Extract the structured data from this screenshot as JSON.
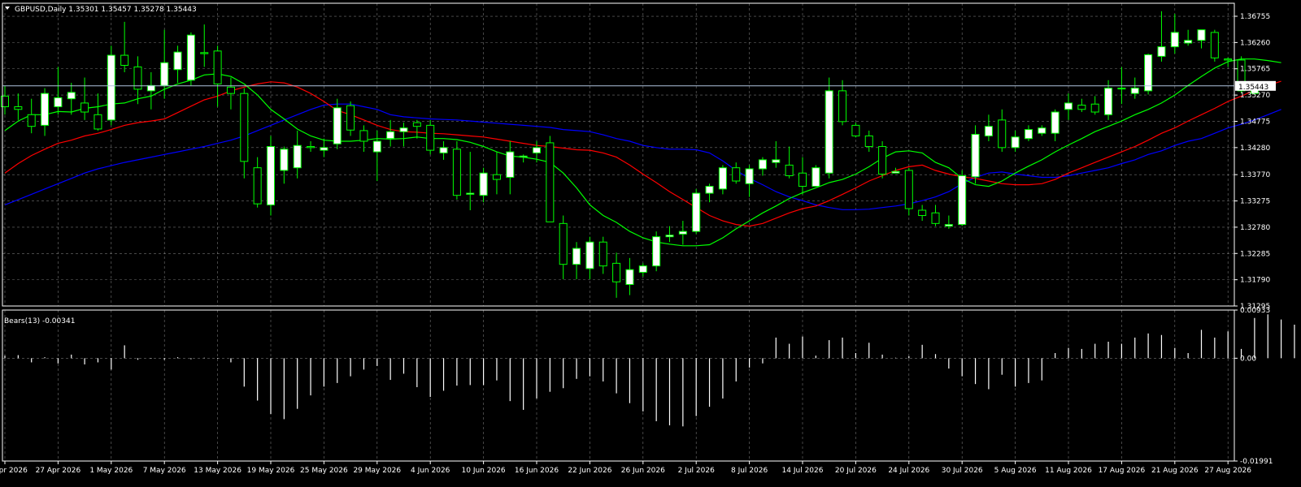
{
  "main_header": "GBPUSD,Daily  1.35301 1.35457 1.35278 1.35443",
  "indicator_header": "Bears(13) -0.00341",
  "current_price_label": "1.35443",
  "colors": {
    "background": "#000000",
    "grid": "#c0c0c0",
    "axis": "#ffffff",
    "bull_candle": "#ffffff",
    "bear_candle": "#000000",
    "wick": "#00ff00",
    "ma_fast": "#00ff00",
    "ma_mid": "#ff0000",
    "ma_slow": "#0000ff",
    "bears_hist": "#ffffff",
    "price_line": "#b0c4de"
  },
  "chart_data": [
    {
      "type": "candlestick",
      "symbol": "GBPUSD",
      "timeframe": "Daily",
      "ylim": [
        1.31295,
        1.37
      ],
      "y_ticks": [
        "1.36755",
        "1.36260",
        "1.35765",
        "1.35270",
        "1.34775",
        "1.34280",
        "1.33770",
        "1.33275",
        "1.32780",
        "1.32285",
        "1.31790",
        "1.31295"
      ],
      "x_ticks": [
        "21 Apr 2026",
        "27 Apr 2026",
        "1 May 2026",
        "7 May 2026",
        "13 May 2026",
        "19 May 2026",
        "25 May 2026",
        "29 May 2026",
        "4 Jun 2026",
        "10 Jun 2026",
        "16 Jun 2026",
        "22 Jun 2026",
        "26 Jun 2026",
        "2 Jul 2026",
        "8 Jul 2026",
        "14 Jul 2026",
        "20 Jul 2026",
        "24 Jul 2026",
        "30 Jul 2026",
        "5 Aug 2026",
        "11 Aug 2026",
        "17 Aug 2026",
        "21 Aug 2026",
        "27 Aug 2026"
      ],
      "grid": true,
      "last_price": 1.35443,
      "candles": [
        [
          1.3525,
          1.3545,
          1.349,
          1.3505
        ],
        [
          1.3505,
          1.353,
          1.348,
          1.35
        ],
        [
          1.349,
          1.352,
          1.3455,
          1.3468
        ],
        [
          1.347,
          1.354,
          1.345,
          1.353
        ],
        [
          1.3505,
          1.358,
          1.349,
          1.3522
        ],
        [
          1.352,
          1.355,
          1.349,
          1.3532
        ],
        [
          1.3512,
          1.356,
          1.348,
          1.3495
        ],
        [
          1.349,
          1.353,
          1.346,
          1.3463
        ],
        [
          1.348,
          1.362,
          1.347,
          1.3602
        ],
        [
          1.3602,
          1.3665,
          1.357,
          1.3583
        ],
        [
          1.358,
          1.36,
          1.351,
          1.3538
        ],
        [
          1.3535,
          1.357,
          1.35,
          1.3545
        ],
        [
          1.3545,
          1.365,
          1.352,
          1.3588
        ],
        [
          1.3575,
          1.362,
          1.355,
          1.3608
        ],
        [
          1.3555,
          1.3645,
          1.3545,
          1.364
        ],
        [
          1.3607,
          1.366,
          1.358,
          1.3605
        ],
        [
          1.361,
          1.362,
          1.3505,
          1.3548
        ],
        [
          1.3542,
          1.356,
          1.35,
          1.353
        ],
        [
          1.353,
          1.354,
          1.337,
          1.3402
        ],
        [
          1.339,
          1.341,
          1.3315,
          1.3322
        ],
        [
          1.332,
          1.345,
          1.33,
          1.343
        ],
        [
          1.3385,
          1.343,
          1.336,
          1.3425
        ],
        [
          1.339,
          1.346,
          1.337,
          1.3432
        ],
        [
          1.343,
          1.344,
          1.342,
          1.3428
        ],
        [
          1.3423,
          1.3445,
          1.341,
          1.3428
        ],
        [
          1.3435,
          1.352,
          1.3425,
          1.3503
        ],
        [
          1.3507,
          1.3515,
          1.345,
          1.3461
        ],
        [
          1.346,
          1.347,
          1.342,
          1.344
        ],
        [
          1.342,
          1.346,
          1.3365,
          1.344
        ],
        [
          1.3445,
          1.348,
          1.343,
          1.3458
        ],
        [
          1.3458,
          1.3475,
          1.343,
          1.3465
        ],
        [
          1.3475,
          1.348,
          1.3445,
          1.3468
        ],
        [
          1.347,
          1.348,
          1.3415,
          1.3423
        ],
        [
          1.3418,
          1.344,
          1.3405,
          1.3428
        ],
        [
          1.3425,
          1.344,
          1.333,
          1.3338
        ],
        [
          1.334,
          1.342,
          1.331,
          1.3342
        ],
        [
          1.3338,
          1.339,
          1.3325,
          1.338
        ],
        [
          1.3377,
          1.342,
          1.334,
          1.3368
        ],
        [
          1.3372,
          1.344,
          1.334,
          1.342
        ],
        [
          1.341,
          1.3415,
          1.34,
          1.3412
        ],
        [
          1.3418,
          1.344,
          1.34,
          1.3428
        ],
        [
          1.3437,
          1.345,
          1.333,
          1.3288
        ],
        [
          1.3285,
          1.33,
          1.318,
          1.3208
        ],
        [
          1.3208,
          1.325,
          1.318,
          1.3238
        ],
        [
          1.32,
          1.326,
          1.318,
          1.325
        ],
        [
          1.325,
          1.326,
          1.319,
          1.3205
        ],
        [
          1.321,
          1.323,
          1.3145,
          1.3175
        ],
        [
          1.317,
          1.322,
          1.315,
          1.3198
        ],
        [
          1.3193,
          1.321,
          1.3185,
          1.3205
        ],
        [
          1.3205,
          1.327,
          1.3195,
          1.326
        ],
        [
          1.326,
          1.328,
          1.325,
          1.3263
        ],
        [
          1.3265,
          1.329,
          1.3245,
          1.327
        ],
        [
          1.327,
          1.335,
          1.3265,
          1.3342
        ],
        [
          1.3342,
          1.336,
          1.3325,
          1.3355
        ],
        [
          1.335,
          1.3395,
          1.334,
          1.339
        ],
        [
          1.339,
          1.34,
          1.336,
          1.3365
        ],
        [
          1.336,
          1.3395,
          1.3335,
          1.3388
        ],
        [
          1.3388,
          1.341,
          1.3375,
          1.3405
        ],
        [
          1.34,
          1.344,
          1.339,
          1.3405
        ],
        [
          1.3395,
          1.343,
          1.337,
          1.3375
        ],
        [
          1.338,
          1.341,
          1.334,
          1.3355
        ],
        [
          1.3355,
          1.3395,
          1.3355,
          1.339
        ],
        [
          1.338,
          1.356,
          1.337,
          1.3535
        ],
        [
          1.3535,
          1.3555,
          1.347,
          1.3477
        ],
        [
          1.347,
          1.3475,
          1.3447,
          1.345
        ],
        [
          1.345,
          1.346,
          1.342,
          1.343
        ],
        [
          1.343,
          1.344,
          1.337,
          1.3378
        ],
        [
          1.338,
          1.339,
          1.338,
          1.3383
        ],
        [
          1.3385,
          1.339,
          1.33,
          1.3313
        ],
        [
          1.331,
          1.332,
          1.329,
          1.33
        ],
        [
          1.3305,
          1.332,
          1.328,
          1.3285
        ],
        [
          1.328,
          1.33,
          1.3275,
          1.3283
        ],
        [
          1.3283,
          1.3385,
          1.328,
          1.3375
        ],
        [
          1.3373,
          1.347,
          1.336,
          1.3453
        ],
        [
          1.345,
          1.349,
          1.344,
          1.3468
        ],
        [
          1.348,
          1.35,
          1.342,
          1.3428
        ],
        [
          1.3428,
          1.346,
          1.342,
          1.3448
        ],
        [
          1.3445,
          1.347,
          1.344,
          1.3462
        ],
        [
          1.3455,
          1.347,
          1.345,
          1.3465
        ],
        [
          1.3455,
          1.35,
          1.344,
          1.3495
        ],
        [
          1.35,
          1.353,
          1.348,
          1.3512
        ],
        [
          1.3508,
          1.352,
          1.3495,
          1.35
        ],
        [
          1.351,
          1.3525,
          1.349,
          1.3495
        ],
        [
          1.349,
          1.3555,
          1.348,
          1.354
        ],
        [
          1.354,
          1.358,
          1.351,
          1.354
        ],
        [
          1.353,
          1.356,
          1.352,
          1.354
        ],
        [
          1.3535,
          1.3605,
          1.3528,
          1.3603
        ],
        [
          1.36,
          1.3685,
          1.359,
          1.3618
        ],
        [
          1.3618,
          1.368,
          1.3605,
          1.3645
        ],
        [
          1.3625,
          1.365,
          1.362,
          1.363
        ],
        [
          1.363,
          1.365,
          1.3615,
          1.365
        ],
        [
          1.3645,
          1.365,
          1.359,
          1.3597
        ],
        [
          1.3595,
          1.3598,
          1.358,
          1.3593
        ],
        [
          1.3593,
          1.36,
          1.353,
          1.3535
        ],
        [
          1.353,
          1.3546,
          1.3528,
          1.3544
        ]
      ],
      "ma_fast": [
        1.346,
        1.3478,
        1.349,
        1.349,
        1.3496,
        1.3495,
        1.3502,
        1.3505,
        1.351,
        1.3512,
        1.352,
        1.3525,
        1.3538,
        1.3548,
        1.3555,
        1.3565,
        1.3567,
        1.3562,
        1.3548,
        1.3527,
        1.35,
        1.3482,
        1.3463,
        1.345,
        1.3442,
        1.344,
        1.344,
        1.3442,
        1.3445,
        1.3444,
        1.3445,
        1.3448,
        1.3445,
        1.3445,
        1.3443,
        1.3438,
        1.343,
        1.342,
        1.3412,
        1.341,
        1.3406,
        1.34,
        1.338,
        1.3352,
        1.332,
        1.33,
        1.3287,
        1.327,
        1.3258,
        1.325,
        1.3246,
        1.3243,
        1.3243,
        1.3245,
        1.3258,
        1.3275,
        1.329,
        1.3305,
        1.3318,
        1.3332,
        1.3343,
        1.3352,
        1.3362,
        1.3368,
        1.3378,
        1.3392,
        1.3408,
        1.342,
        1.3422,
        1.3418,
        1.34,
        1.339,
        1.337,
        1.3358,
        1.3355,
        1.3365,
        1.338,
        1.3393,
        1.3405,
        1.342,
        1.3433,
        1.3445,
        1.3458,
        1.3468,
        1.3478,
        1.349,
        1.35,
        1.3512,
        1.3527,
        1.3545,
        1.3562,
        1.3578,
        1.359,
        1.3595,
        1.3595,
        1.3592,
        1.3588
      ],
      "ma_mid": [
        1.338,
        1.3398,
        1.3413,
        1.3425,
        1.3436,
        1.3442,
        1.345,
        1.3455,
        1.3462,
        1.347,
        1.3475,
        1.3478,
        1.3482,
        1.3494,
        1.3506,
        1.3518,
        1.3525,
        1.3535,
        1.3542,
        1.3548,
        1.3552,
        1.355,
        1.3542,
        1.353,
        1.3515,
        1.3498,
        1.349,
        1.348,
        1.347,
        1.3462,
        1.3458,
        1.3457,
        1.3455,
        1.3454,
        1.3452,
        1.345,
        1.3448,
        1.3444,
        1.344,
        1.3436,
        1.3432,
        1.343,
        1.3427,
        1.3424,
        1.3423,
        1.3418,
        1.341,
        1.3395,
        1.3378,
        1.3362,
        1.3345,
        1.333,
        1.3315,
        1.33,
        1.329,
        1.3283,
        1.328,
        1.3285,
        1.3295,
        1.3305,
        1.3313,
        1.3318,
        1.3328,
        1.334,
        1.3352,
        1.3365,
        1.3375,
        1.3385,
        1.3392,
        1.3395,
        1.3385,
        1.3378,
        1.3373,
        1.337,
        1.3365,
        1.336,
        1.3358,
        1.3358,
        1.336,
        1.3368,
        1.338,
        1.339,
        1.34,
        1.341,
        1.342,
        1.343,
        1.3442,
        1.3455,
        1.3465,
        1.3478,
        1.349,
        1.3502,
        1.3515,
        1.3525,
        1.3536,
        1.3545,
        1.3553
      ],
      "ma_slow": [
        1.332,
        1.333,
        1.334,
        1.335,
        1.336,
        1.337,
        1.338,
        1.3388,
        1.3394,
        1.34,
        1.3405,
        1.341,
        1.3415,
        1.342,
        1.3425,
        1.343,
        1.3436,
        1.3442,
        1.345,
        1.346,
        1.347,
        1.348,
        1.349,
        1.35,
        1.3508,
        1.351,
        1.351,
        1.3505,
        1.35,
        1.349,
        1.3486,
        1.3484,
        1.3482,
        1.3481,
        1.348,
        1.3478,
        1.3476,
        1.3474,
        1.3472,
        1.347,
        1.3468,
        1.3466,
        1.3462,
        1.346,
        1.3458,
        1.3452,
        1.3445,
        1.344,
        1.3432,
        1.3428,
        1.3425,
        1.3425,
        1.3424,
        1.3418,
        1.3403,
        1.3385,
        1.337,
        1.3358,
        1.3345,
        1.3335,
        1.3328,
        1.332,
        1.3315,
        1.3311,
        1.3311,
        1.3312,
        1.3315,
        1.3318,
        1.3322,
        1.3328,
        1.3335,
        1.3345,
        1.336,
        1.3372,
        1.338,
        1.3382,
        1.3378,
        1.3375,
        1.3372,
        1.3372,
        1.3375,
        1.338,
        1.3385,
        1.339,
        1.3398,
        1.3405,
        1.3415,
        1.3422,
        1.3432,
        1.344,
        1.3445,
        1.3455,
        1.3465,
        1.3472,
        1.348,
        1.349,
        1.35
      ]
    },
    {
      "type": "bar",
      "name": "Bears(13)",
      "ylim": [
        -0.01991,
        0.00933
      ],
      "y_ticks": [
        "0.00933",
        "0.00",
        "-0.01991"
      ],
      "values": [
        0.0005,
        0.0006,
        -0.0008,
        0.0002,
        -0.001,
        0.0007,
        -0.0012,
        -0.0008,
        -0.0022,
        0.0025,
        -0.0003,
        -0.0001,
        -0.0003,
        0.0002,
        -0.0002,
        0.0001,
        -0.0001,
        -0.0008,
        -0.0055,
        -0.0082,
        -0.0108,
        -0.0118,
        -0.0098,
        -0.0072,
        -0.0055,
        -0.0048,
        -0.0035,
        -0.0022,
        -0.0015,
        -0.0042,
        -0.003,
        -0.0056,
        -0.0075,
        -0.0063,
        -0.0053,
        -0.0052,
        -0.0052,
        -0.0043,
        -0.0083,
        -0.01,
        -0.0078,
        -0.0065,
        -0.0058,
        -0.004,
        -0.0035,
        -0.0045,
        -0.0068,
        -0.0087,
        -0.0103,
        -0.0122,
        -0.013,
        -0.0132,
        -0.0112,
        -0.0094,
        -0.0078,
        -0.0045,
        -0.0018,
        -0.001,
        0.004,
        0.0028,
        0.0042,
        0.0005,
        0.0035,
        0.004,
        0.001,
        0.003,
        0.0007,
        0.0001,
        0.0004,
        0.0026,
        0.0008,
        -0.002,
        -0.0035,
        -0.005,
        -0.006,
        -0.0032,
        -0.0055,
        -0.0048,
        -0.0043,
        0.001,
        0.002,
        0.0018,
        0.0028,
        0.0032,
        0.0028,
        0.004,
        0.0048,
        0.0045,
        0.002,
        0.001,
        0.0055,
        0.004,
        0.0052,
        0.0018,
        0.0078,
        0.0085,
        0.0075,
        0.0065,
        0.001,
        -0.004,
        -0.0034
      ]
    }
  ]
}
